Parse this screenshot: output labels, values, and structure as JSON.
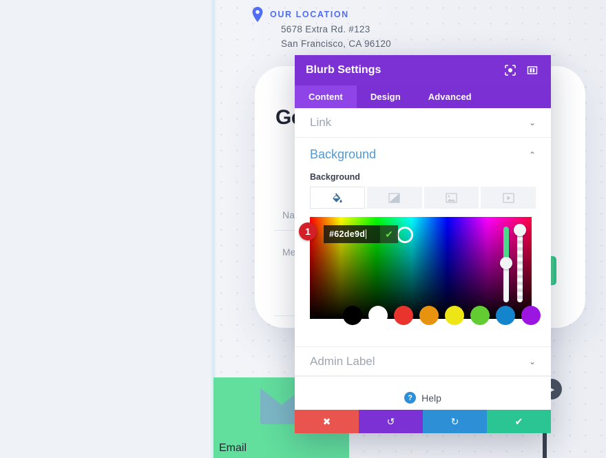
{
  "page": {
    "location": {
      "icon": "map-pin-icon",
      "title": "OUR LOCATION",
      "address_line_1": "5678 Extra Rd. #123",
      "address_line_2": "San Francisco, CA 96120",
      "accent_color": "#4f6df5"
    },
    "contact_card": {
      "heading": "Ge",
      "name_label": "Na",
      "message_label": "Me"
    },
    "blurb_module": {
      "label": "Email",
      "icon": "envelope-icon",
      "background_color": "#62de9d"
    },
    "right_rail": {
      "toggle_icon": "chevron-right-icon",
      "thumb_color": "#4ecb8c"
    }
  },
  "modal": {
    "title": "Blurb Settings",
    "header_buttons": [
      {
        "name": "focus-mode-icon",
        "label": ""
      },
      {
        "name": "split-view-icon",
        "label": ""
      }
    ],
    "tabs": [
      {
        "label": "Content",
        "active": true
      },
      {
        "label": "Design",
        "active": false
      },
      {
        "label": "Advanced",
        "active": false
      }
    ],
    "sections": {
      "link": {
        "label": "Link",
        "state": "collapsed",
        "chevron": "chevron-down-icon"
      },
      "background": {
        "label": "Background",
        "state": "expanded",
        "chevron": "chevron-up-icon",
        "field_label": "Background",
        "types": [
          {
            "name": "background-color-tab",
            "icon": "paint-bucket-icon",
            "active": true
          },
          {
            "name": "background-gradient-tab",
            "icon": "gradient-icon",
            "active": false
          },
          {
            "name": "background-image-tab",
            "icon": "image-icon",
            "active": false
          },
          {
            "name": "background-video-tab",
            "icon": "video-icon",
            "active": false
          }
        ],
        "color_picker": {
          "hex_value": "#62de9d",
          "confirm_icon": "checkmark-icon",
          "badge": "1",
          "hue_slider_value": 42,
          "alpha_slider_value": 100,
          "presets": [
            {
              "name": "swatch-black",
              "color": "#000000"
            },
            {
              "name": "swatch-white",
              "color": "#ffffff"
            },
            {
              "name": "swatch-red",
              "color": "#e8342c"
            },
            {
              "name": "swatch-orange",
              "color": "#e8930f"
            },
            {
              "name": "swatch-yellow",
              "color": "#ede516"
            },
            {
              "name": "swatch-green",
              "color": "#63cc32"
            },
            {
              "name": "swatch-blue",
              "color": "#1484cc"
            },
            {
              "name": "swatch-purple",
              "color": "#9b16e0"
            }
          ]
        }
      },
      "admin_label": {
        "label": "Admin Label",
        "state": "collapsed",
        "chevron": "chevron-down-icon"
      }
    },
    "help": {
      "icon": "question-mark-icon",
      "label": "Help"
    },
    "footer": [
      {
        "name": "cancel-button",
        "icon": "✖",
        "color": "#e9544e"
      },
      {
        "name": "undo-button",
        "icon": "↺",
        "color": "#7b31d4"
      },
      {
        "name": "redo-button",
        "icon": "↻",
        "color": "#2d8fd5"
      },
      {
        "name": "save-button",
        "icon": "✔",
        "color": "#2bc493"
      }
    ]
  }
}
